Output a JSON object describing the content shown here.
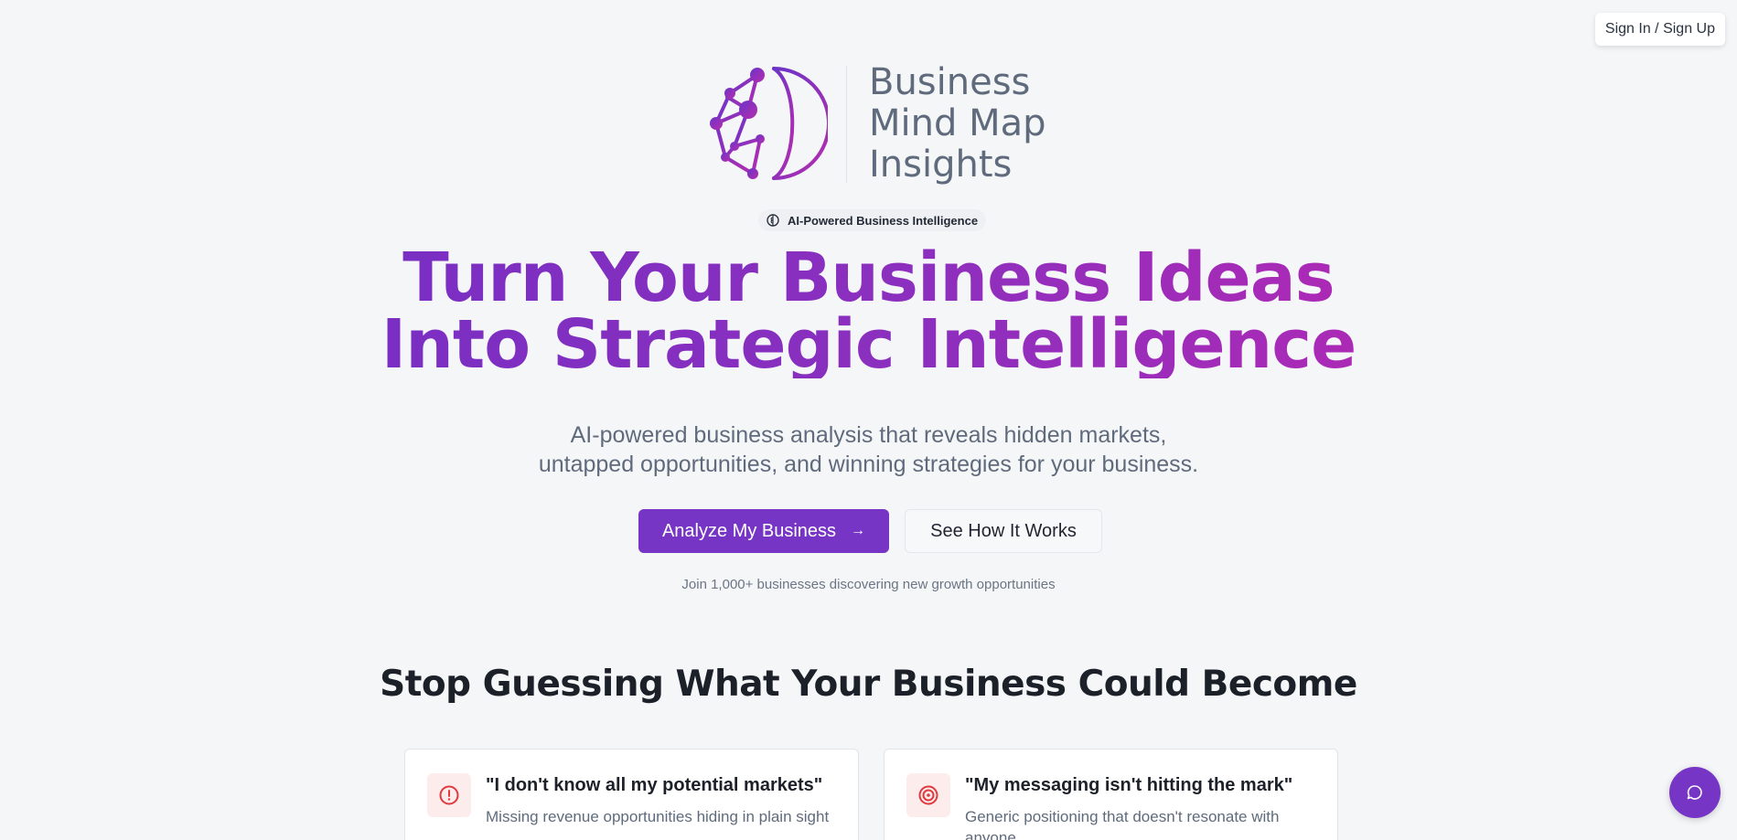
{
  "header": {
    "signin_label": "Sign In / Sign Up"
  },
  "logo": {
    "line1": "Business",
    "line2": "Mind Map",
    "line3": "Insights",
    "icon": "brain-globe-icon"
  },
  "hero": {
    "badge": "AI-Powered Business Intelligence",
    "badge_icon": "brain-icon",
    "headline_line1": "Turn Your Business Ideas",
    "headline_line2": "Into Strategic Intelligence",
    "sub_line1": "AI-powered business analysis that reveals hidden markets,",
    "sub_line2": "untapped opportunities, and winning strategies for your business.",
    "primary_cta": "Analyze My Business",
    "secondary_cta": "See How It Works",
    "social_proof": "Join 1,000+ businesses discovering new growth opportunities"
  },
  "problems": {
    "title": "Stop Guessing What Your Business Could Become",
    "cards": [
      {
        "title": "\"I don't know all my potential markets\"",
        "desc": "Missing revenue opportunities hiding in plain sight",
        "icon": "alert-circle-icon"
      },
      {
        "title": "\"My messaging isn't hitting the mark\"",
        "desc": "Generic positioning that doesn't resonate with anyone",
        "icon": "target-icon"
      }
    ]
  },
  "chat": {
    "icon": "chat-icon"
  },
  "colors": {
    "brand_purple": "#7735c6",
    "gradient_start": "#7a2fc2",
    "gradient_end": "#ab2ab6",
    "alert_red": "#e0393e",
    "background": "#f5f6f8"
  }
}
